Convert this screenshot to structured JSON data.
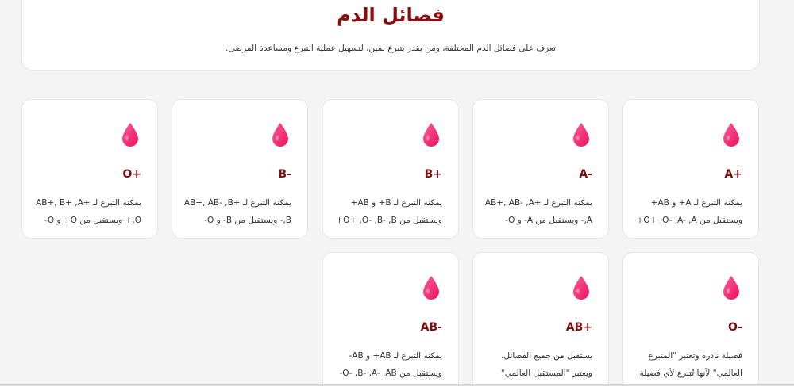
{
  "header": {
    "title": "فصائل الدم",
    "subtitle": "تعرف على فصائل الدم المختلفة، ومن يقدر يتبرع لمين، لتسهيل عملية التبرع ومساعدة المرضى."
  },
  "colors": {
    "title": "#8b0d0d",
    "type_name": "#7a0f0f",
    "drop": "#ff2e7a"
  },
  "cards": [
    {
      "type": "A+",
      "icon": "blood-drop-icon",
      "desc": "يمكنه التبرع لـ A+ و AB+ ويستقبل من O+ ,O- ,A- ,A+"
    },
    {
      "type": "A-",
      "icon": "blood-drop-icon",
      "desc": "يمكنه التبرع لـ AB+, AB- ,A+ ,A- ويستقبل من A- و O-"
    },
    {
      "type": "B+",
      "icon": "blood-drop-icon",
      "desc": "يمكنه التبرع لـ B+ و AB+ ويستقبل من O+ ,O- ,B- ,B+"
    },
    {
      "type": "B-",
      "icon": "blood-drop-icon",
      "desc": "يمكنه التبرع لـ AB+, AB- ,B+ ,B- ويستقبل من B- و O-"
    },
    {
      "type": "O+",
      "icon": "blood-drop-icon",
      "desc": "يمكنه التبرع لـ AB+, B+ ,A+ ,O+ ويستقبل من O+ و O-"
    },
    {
      "type": "O-",
      "icon": "blood-drop-icon",
      "desc": "فصيلة نادرة وتعتبر \"المتبرع العالمي\" لأنها تُتبرع لأي فصيلة"
    },
    {
      "type": "AB+",
      "icon": "blood-drop-icon",
      "desc": "يستقبل من جميع الفصائل، ويعتبر \"المستقبل العالمي\""
    },
    {
      "type": "AB-",
      "icon": "blood-drop-icon",
      "desc": "يمكنه التبرع لـ AB+ و AB- ويستقبل من O- ,B- ,A- ,AB-"
    }
  ]
}
